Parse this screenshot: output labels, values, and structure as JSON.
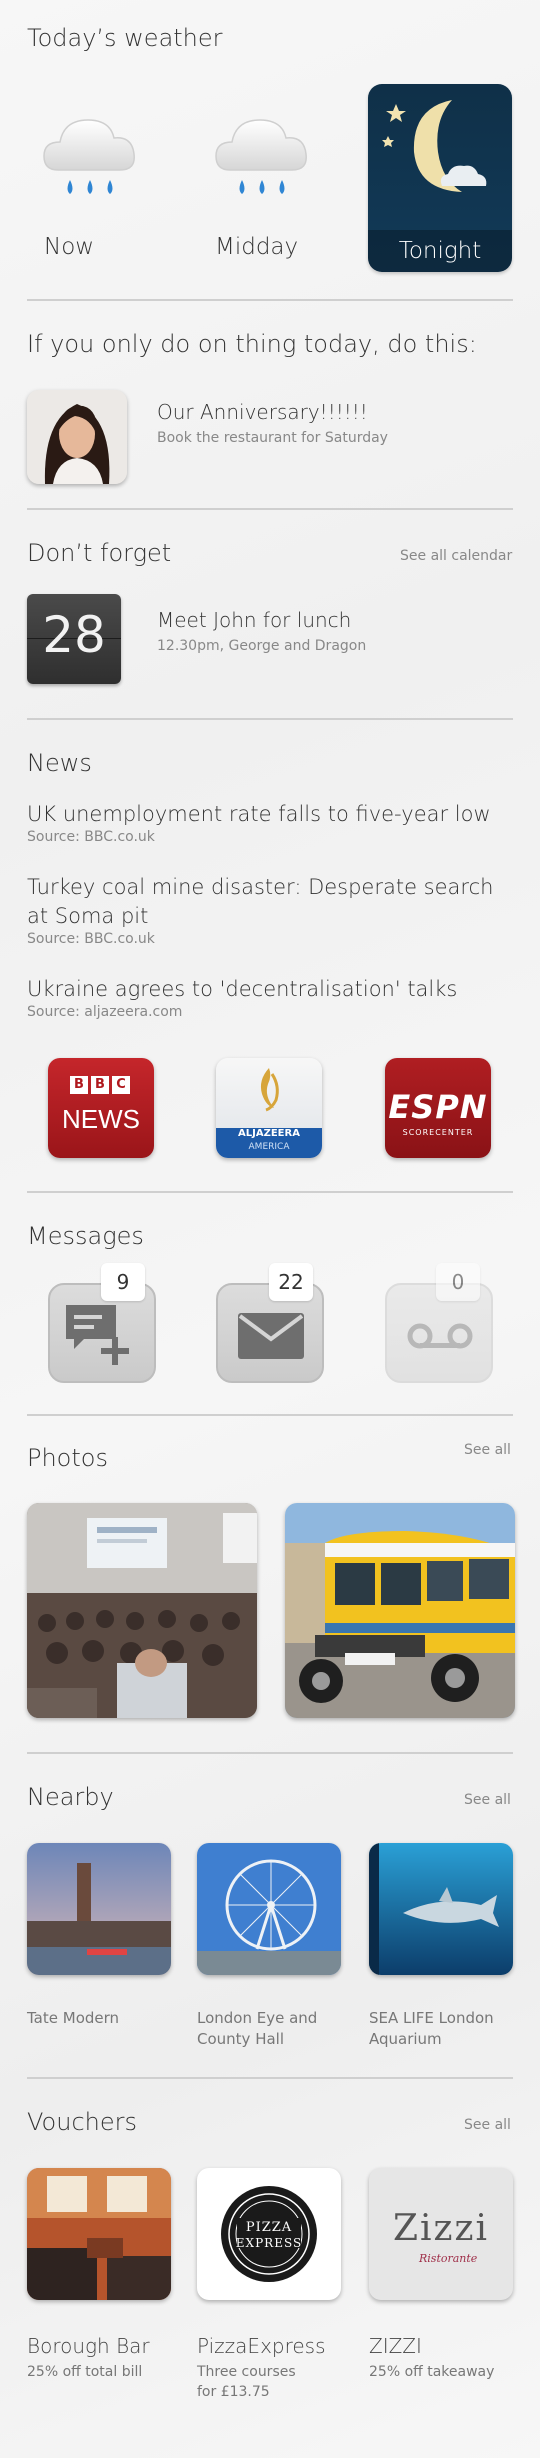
{
  "weather": {
    "heading": "Today’s weather",
    "items": [
      {
        "label": "Now",
        "icon": "rain-cloud-icon"
      },
      {
        "label": "Midday",
        "icon": "rain-cloud-icon"
      },
      {
        "label": "Tonight",
        "icon": "moon-night-icon"
      }
    ]
  },
  "focus": {
    "heading": "If you only do on thing today, do this:",
    "title": "Our Anniversary!!!!!!",
    "subtitle": "Book the restaurant for Saturday"
  },
  "calendar": {
    "heading": "Don’t forget",
    "link": "See all calendar",
    "day": "28",
    "title": "Meet John for lunch",
    "subtitle": "12.30pm, George and Dragon"
  },
  "news": {
    "heading": "News",
    "items": [
      {
        "title": "UK unemployment rate falls to five-year low",
        "source": "Source: BBC.co.uk"
      },
      {
        "title": "Turkey coal mine disaster: Desperate search at Soma pit",
        "source": "Source: BBC.co.uk"
      },
      {
        "title": "Ukraine agrees to 'decentralisation' talks",
        "source": "Source: aljazeera.com"
      }
    ],
    "apps": [
      {
        "line1": "BBC",
        "line2": "NEWS"
      },
      {
        "line1": "ALJAZEERA",
        "line2": "AMERICA"
      },
      {
        "line1": "ESPN",
        "line2": "SCORECENTER"
      }
    ]
  },
  "messages": {
    "heading": "Messages",
    "counts": [
      "9",
      "22",
      "0"
    ]
  },
  "photos": {
    "heading": "Photos",
    "link": "See all"
  },
  "nearby": {
    "heading": "Nearby",
    "link": "See all",
    "items": [
      {
        "line1": "Tate Modern",
        "line2": ""
      },
      {
        "line1": "London Eye and",
        "line2": "County Hall"
      },
      {
        "line1": "SEA LIFE London",
        "line2": "Aquarium"
      }
    ]
  },
  "vouchers": {
    "heading": "Vouchers",
    "link": "See all",
    "items": [
      {
        "name": "Borough Bar",
        "line1": "25% off total bill",
        "line2": ""
      },
      {
        "name": "PizzaExpress",
        "line1": "Three courses",
        "line2": "for £13.75"
      },
      {
        "name": "ZIZZI",
        "line1": "25% off takeaway",
        "line2": ""
      }
    ],
    "logo_pizza_1": "PIZZA",
    "logo_pizza_2": "EXPRESS",
    "logo_zizzi": "Zizzi",
    "logo_zizzi_sub": "Ristorante"
  }
}
